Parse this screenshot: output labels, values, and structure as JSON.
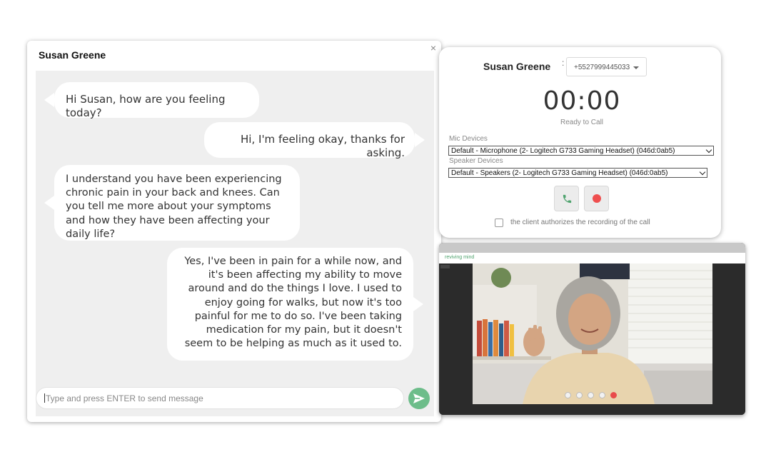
{
  "chat": {
    "title": "Susan Greene",
    "close_icon": "×",
    "messages": [
      {
        "direction": "incoming",
        "text": "Hi Susan, how are you feeling today?"
      },
      {
        "direction": "outgoing",
        "text": "Hi, I'm feeling okay, thanks for asking."
      },
      {
        "direction": "incoming",
        "text": "I understand you have been experiencing chronic pain in your back and knees. Can you tell me more about your symptoms and how they have been affecting your daily life?"
      },
      {
        "direction": "outgoing",
        "text": "Yes, I've been in pain for a while now, and it's been affecting my ability to move around and do the things I love. I used to enjoy going for walks, but now it's too painful for me to do so. I've been taking medication for my pain, but it doesn't seem to be helping as much as it used to."
      }
    ],
    "input_placeholder": "Type and press ENTER to send message",
    "send_icon": "send-icon"
  },
  "dialer": {
    "contact_name": "Susan Greene",
    "separator": ":",
    "phone_number": "+5527999445033",
    "timer": "00:00",
    "status": "Ready to Call",
    "mic_label": "Mic Devices",
    "mic_value": "Default - Microphone (2- Logitech G733 Gaming Headset) (046d:0ab5)",
    "speaker_label": "Speaker Devices",
    "speaker_value": "Default - Speakers (2- Logitech G733 Gaming Headset) (046d:0ab5)",
    "call_icon": "phone-icon",
    "record_icon": "record-icon",
    "consent_text": "the client authorizes the recording of the call"
  },
  "video": {
    "brand": "reviving mind",
    "colors": {
      "brand": "#4fa36e",
      "accent": "#6dbd8a",
      "record": "#ef4f4f"
    }
  }
}
